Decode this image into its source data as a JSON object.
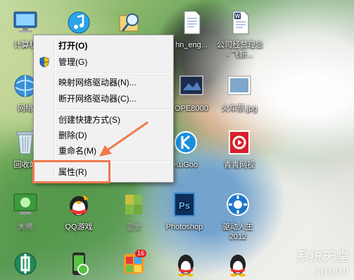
{
  "desktop_icons": [
    {
      "id": "computer",
      "label": "计算机",
      "icon": "computer-icon"
    },
    {
      "id": "itunes",
      "label": "",
      "icon": "itunes-icon"
    },
    {
      "id": "search",
      "label": "",
      "icon": "search-folder-icon"
    },
    {
      "id": "network",
      "label": "网络",
      "icon": "network-icon"
    },
    {
      "id": "recycle",
      "label": "回收站",
      "icon": "recycle-bin-icon"
    },
    {
      "id": "doc1",
      "label": "hn_eng...",
      "icon": "word-document-icon"
    },
    {
      "id": "doc2",
      "label": "公司经营理念 - 飞新...",
      "icon": "word-document-icon"
    },
    {
      "id": "pic1",
      "label": "OPE8000",
      "icon": "image-file-icon"
    },
    {
      "id": "pic2",
      "label": "火车票.jpg",
      "icon": "image-file-icon"
    },
    {
      "id": "kugoo",
      "label": "KuGoo",
      "icon": "kugoo-icon"
    },
    {
      "id": "qingqing",
      "label": "青青网视",
      "icon": "qingqing-tv-icon"
    },
    {
      "id": "master",
      "label": "大师",
      "icon": "hardware-master-icon"
    },
    {
      "id": "qqgame",
      "label": "QQ游戏",
      "icon": "qq-game-icon"
    },
    {
      "id": "blur2",
      "label": "卫士",
      "icon": "security-guard-icon"
    },
    {
      "id": "photoshop",
      "label": "Photoshop",
      "icon": "photoshop-icon"
    },
    {
      "id": "driver",
      "label": "驱动人生 2012",
      "icon": "driver-life-icon"
    },
    {
      "id": "bank",
      "label": "",
      "icon": "bank-icon"
    },
    {
      "id": "phone",
      "label": "",
      "icon": "phone-assistant-icon"
    },
    {
      "id": "apps",
      "label": "",
      "icon": "app-store-icon"
    },
    {
      "id": "qq1",
      "label": "",
      "icon": "qq-penguin-icon"
    },
    {
      "id": "qq2",
      "label": "",
      "icon": "qq-penguin-icon"
    }
  ],
  "apps_badge": "16",
  "context_menu": {
    "items": [
      {
        "label": "打开(O)",
        "bold": true
      },
      {
        "label": "管理(G)",
        "icon": "uac-shield-icon"
      },
      {
        "label": "映射网络驱动器(N)..."
      },
      {
        "label": "断开网络驱动器(C)..."
      },
      {
        "label": "创建快捷方式(S)"
      },
      {
        "label": "删除(D)"
      },
      {
        "label": "重命名(M)"
      },
      {
        "label": "属性(R)"
      }
    ]
  },
  "watermark": {
    "line1": "系统天堂",
    "line2": "xpgod"
  },
  "colors": {
    "annotation": "#f0794e",
    "menu_bg": "#f1f1f1",
    "menu_border": "#979797"
  }
}
